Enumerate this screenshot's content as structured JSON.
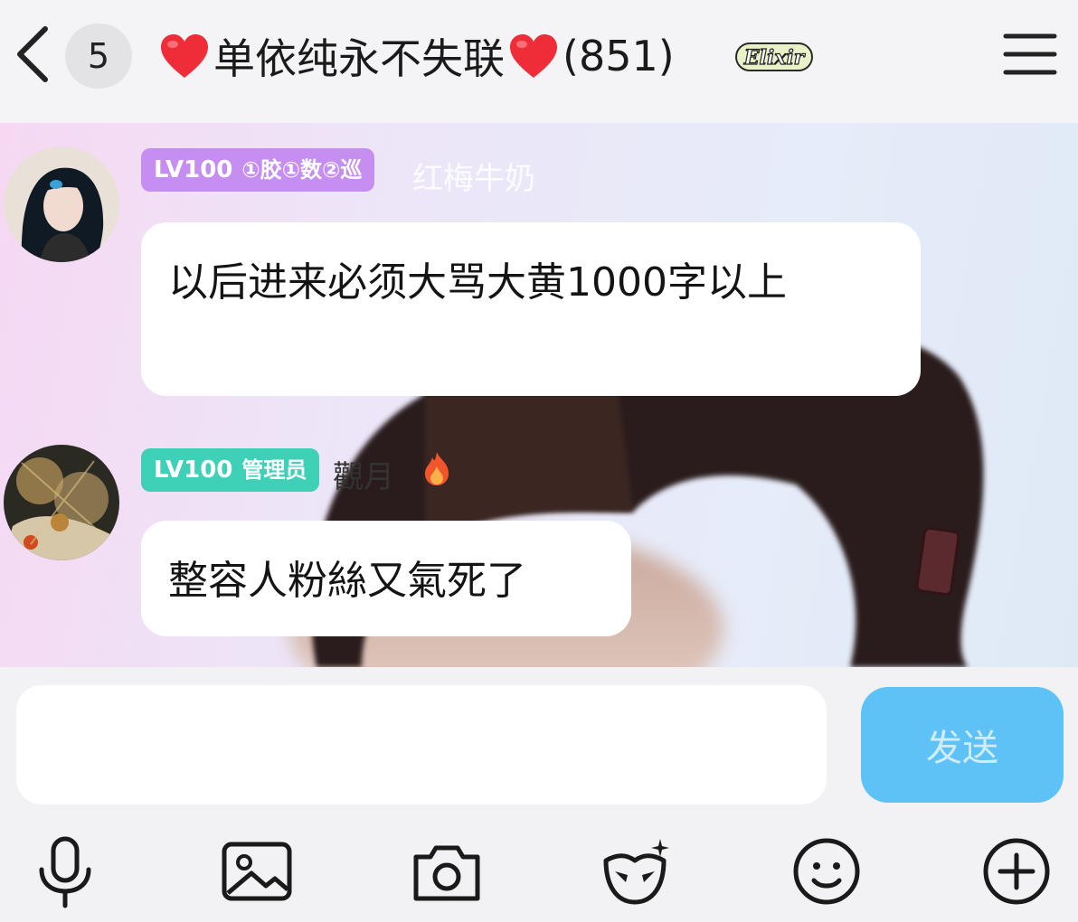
{
  "header": {
    "back_icon": "chevron-left-icon",
    "unread_count": "5",
    "title_heart_icon": "red-heart-emoji",
    "group_name": "单依纯永不失联",
    "member_count": "(851)",
    "badge_text": "Elixir",
    "menu_icon": "hamburger-menu-icon"
  },
  "messages": [
    {
      "level": "LV100",
      "tags": "①胶①数②巡",
      "tag_color": "#c58ef0",
      "sender": "红梅牛奶",
      "text": "以后进来必须大骂大黄1000字以上"
    },
    {
      "level": "LV100",
      "tags": "管理员",
      "tag_color": "#3ed1b7",
      "sender": "觀月",
      "sender_icon": "flame-icon",
      "text": "整容人粉絲又氣死了"
    }
  ],
  "composer": {
    "input_value": "",
    "send_label": "发送",
    "send_color": "#5ec2f6"
  },
  "toolbar": {
    "icons": [
      "microphone-icon",
      "image-icon",
      "camera-icon",
      "mask-sticker-icon",
      "smiley-icon",
      "plus-icon"
    ]
  }
}
